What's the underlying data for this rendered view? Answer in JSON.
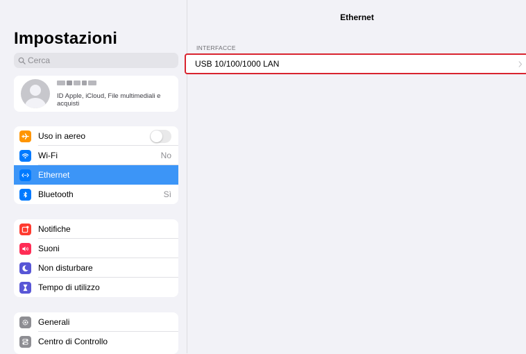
{
  "sidebar": {
    "title": "Impostazioni",
    "search_placeholder": "Cerca",
    "profile": {
      "subtitle": "ID Apple, iCloud, File multimediali e acquisti"
    },
    "groups": [
      [
        {
          "label": "Uso in aereo",
          "icon": "airplane-icon",
          "color": "#ff9500",
          "value": ""
        },
        {
          "label": "Wi-Fi",
          "icon": "wifi-icon",
          "color": "#007aff",
          "value": "No"
        },
        {
          "label": "Ethernet",
          "icon": "ethernet-icon",
          "color": "#007aff",
          "value": ""
        },
        {
          "label": "Bluetooth",
          "icon": "bluetooth-icon",
          "color": "#007aff",
          "value": "Sì"
        }
      ],
      [
        {
          "label": "Notifiche",
          "icon": "notifications-icon",
          "color": "#ff3b30"
        },
        {
          "label": "Suoni",
          "icon": "speaker-icon",
          "color": "#ff2d55"
        },
        {
          "label": "Non disturbare",
          "icon": "moon-icon",
          "color": "#5856d6"
        },
        {
          "label": "Tempo di utilizzo",
          "icon": "hourglass-icon",
          "color": "#5856d6"
        }
      ],
      [
        {
          "label": "Generali",
          "icon": "gear-icon",
          "color": "#8e8e93"
        },
        {
          "label": "Centro di Controllo",
          "icon": "control-center-icon",
          "color": "#8e8e93"
        }
      ]
    ],
    "airplane_mode_on": false,
    "selected_color": "#3c95f7"
  },
  "detail": {
    "title": "Ethernet",
    "section_header": "INTERFACCE",
    "interface_label": "USB 10/100/1000 LAN",
    "highlight_color": "#d9232e"
  }
}
